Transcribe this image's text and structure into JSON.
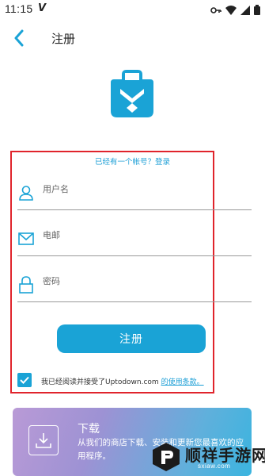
{
  "status_bar": {
    "time": "11:15",
    "carrier_glyph": "V",
    "icons": [
      "key-icon",
      "wifi-icon",
      "signal-icon",
      "battery-icon"
    ]
  },
  "header": {
    "title": "注册",
    "back_icon": "chevron-left-icon"
  },
  "form": {
    "login_prompt": "已经有一个帐号？登录",
    "username_placeholder": "用户名",
    "email_placeholder": "电邮",
    "password_placeholder": "密码",
    "register_label": "注册",
    "terms_checked": true,
    "terms_text": "我已经阅读并接受了Uptodown.com ",
    "terms_link": "的使用条款。"
  },
  "download_card": {
    "title": "下载",
    "description": "从我们的商店下载、安装和更新您最喜欢的应用程序。"
  },
  "watermark": {
    "text": "顺祥手游网",
    "url": "sxiaw.com"
  },
  "colors": {
    "accent": "#1aa3d6",
    "highlight": "#e0242c"
  }
}
